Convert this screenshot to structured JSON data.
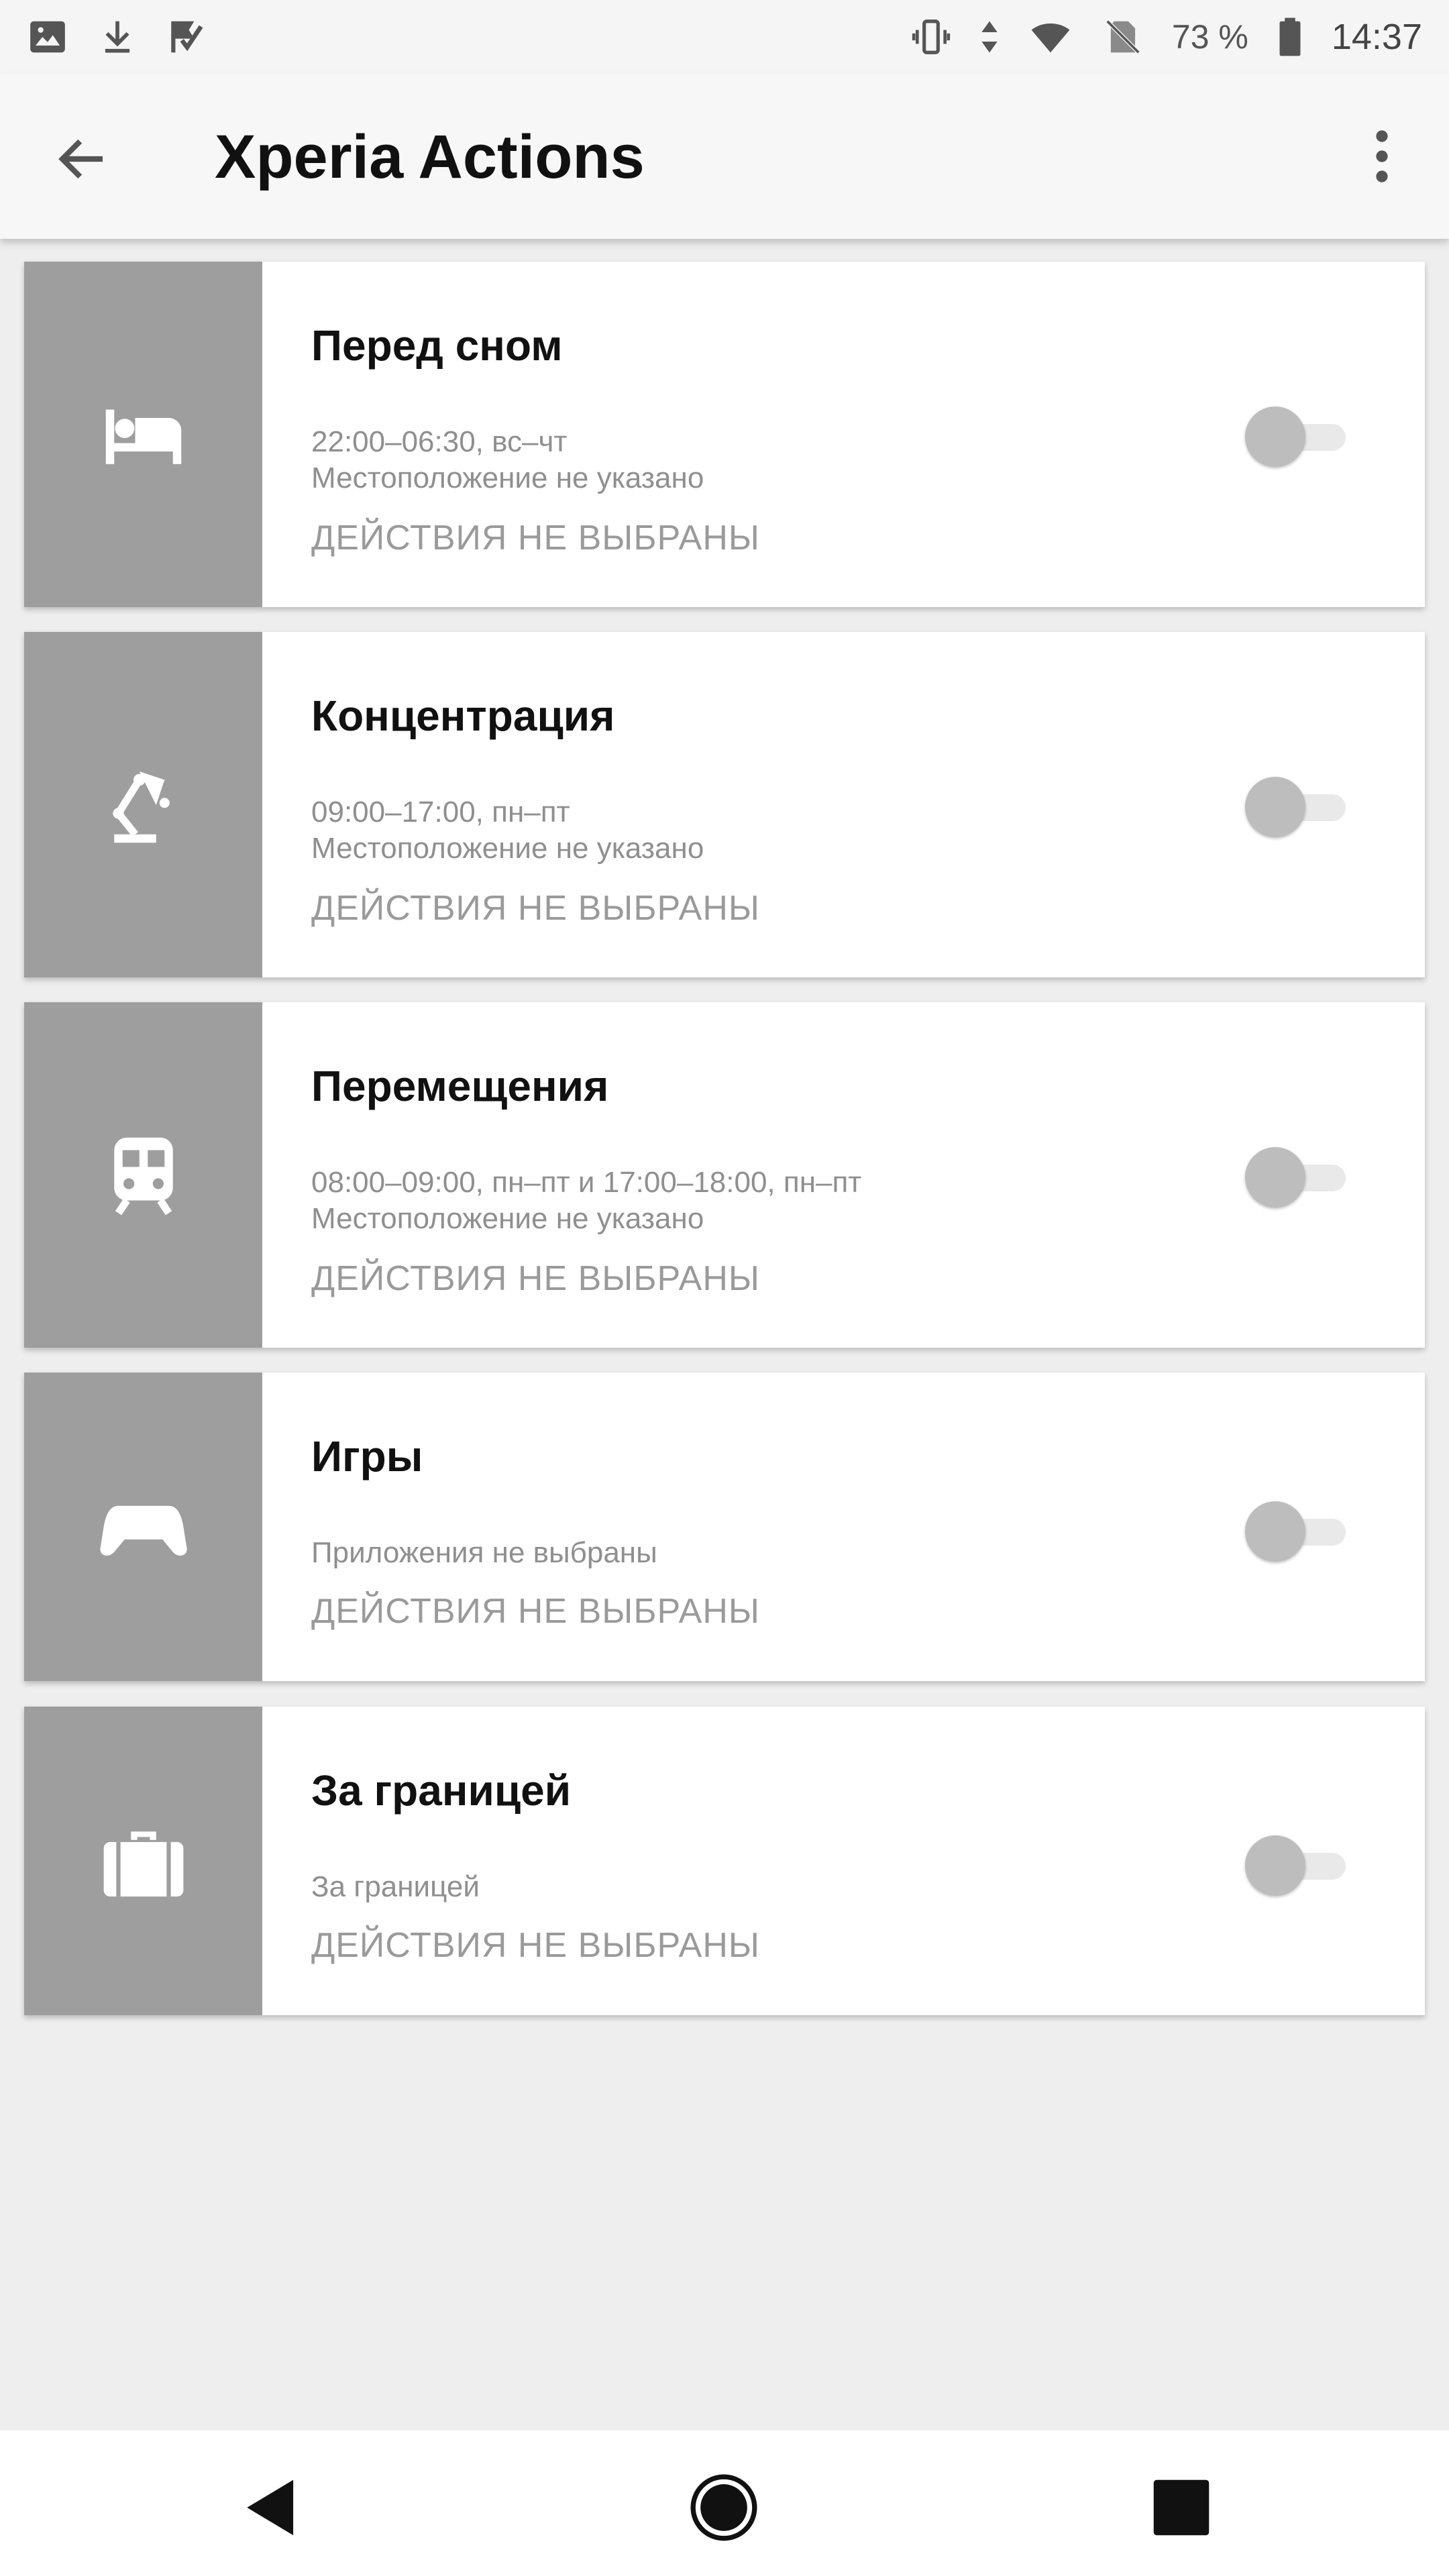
{
  "status_bar": {
    "battery_percent": "73 %",
    "time": "14:37",
    "icons": [
      "image-icon",
      "download-icon",
      "task-check-icon",
      "vibrate-icon",
      "data-arrows-icon",
      "wifi-icon",
      "no-sim-icon",
      "battery-icon"
    ]
  },
  "app_bar": {
    "title": "Xperia Actions",
    "back_icon": "arrow-left-icon",
    "menu_icon": "more-vert-icon"
  },
  "cards": [
    {
      "title": "Перед сном",
      "icon": "bed-icon",
      "lines": [
        "22:00–06:30, вс–чт",
        "Местоположение не указано"
      ],
      "actions": "ДЕЙСТВИЯ НЕ ВЫБРАНЫ",
      "enabled": false
    },
    {
      "title": "Концентрация",
      "icon": "desk-lamp-icon",
      "lines": [
        "09:00–17:00, пн–пт",
        "Местоположение не указано"
      ],
      "actions": "ДЕЙСТВИЯ НЕ ВЫБРАНЫ",
      "enabled": false
    },
    {
      "title": "Перемещения",
      "icon": "train-icon",
      "lines": [
        "08:00–09:00, пн–пт и 17:00–18:00, пн–пт",
        "Местоположение не указано"
      ],
      "actions": "ДЕЙСТВИЯ НЕ ВЫБРАНЫ",
      "enabled": false
    },
    {
      "title": "Игры",
      "icon": "gamepad-icon",
      "lines": [
        "Приложения не выбраны"
      ],
      "actions": "ДЕЙСТВИЯ НЕ ВЫБРАНЫ",
      "enabled": false
    },
    {
      "title": "За границей",
      "icon": "suitcase-icon",
      "lines": [
        "За границей"
      ],
      "actions": "ДЕЙСТВИЯ НЕ ВЫБРАНЫ",
      "enabled": false
    }
  ],
  "nav_bar": {
    "icons": [
      "nav-back-icon",
      "nav-home-icon",
      "nav-recents-icon"
    ]
  }
}
